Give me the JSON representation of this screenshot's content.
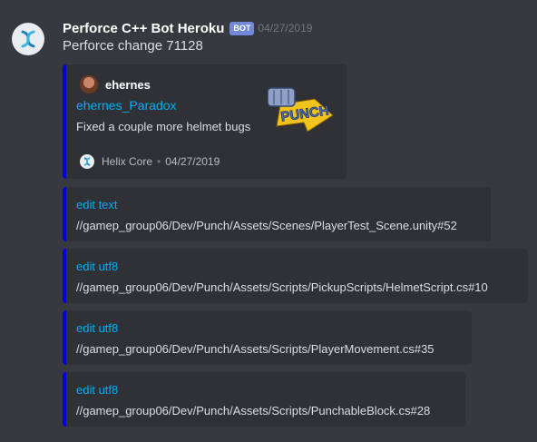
{
  "message": {
    "username": "Perforce C++ Bot Heroku",
    "bot_tag": "BOT",
    "timestamp": "04/27/2019",
    "content": "Perforce change 71128",
    "avatar_icon": "helix-logo-icon"
  },
  "embed": {
    "author": "ehernes",
    "title": "ehernes_Paradox",
    "description": "Fixed a couple more helmet bugs",
    "footer_name": "Helix Core",
    "footer_separator": "•",
    "footer_date": "04/27/2019",
    "thumbnail_text": "PUNCH",
    "accent_color": "#0000dd"
  },
  "files": [
    {
      "action": "edit text",
      "path": "//gamep_group06/Dev/Punch/Assets/Scenes/PlayerTest_Scene.unity#52"
    },
    {
      "action": "edit utf8",
      "path": "//gamep_group06/Dev/Punch/Assets/Scripts/PickupScripts/HelmetScript.cs#10"
    },
    {
      "action": "edit utf8",
      "path": "//gamep_group06/Dev/Punch/Assets/Scripts/PlayerMovement.cs#35"
    },
    {
      "action": "edit utf8",
      "path": "//gamep_group06/Dev/Punch/Assets/Scripts/PunchableBlock.cs#28"
    }
  ]
}
